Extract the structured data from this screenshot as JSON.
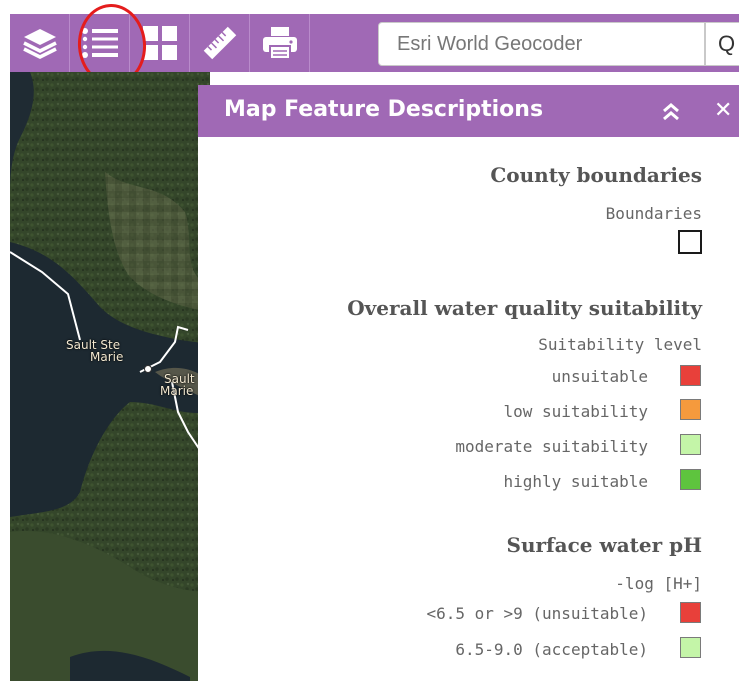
{
  "toolbar": {
    "buttons": [
      {
        "name": "layers",
        "icon": "layers-icon"
      },
      {
        "name": "legend",
        "icon": "list-icon"
      },
      {
        "name": "basemap",
        "icon": "grid-icon"
      },
      {
        "name": "measure",
        "icon": "ruler-icon"
      },
      {
        "name": "print",
        "icon": "printer-icon"
      }
    ],
    "highlighted_button": "legend",
    "search": {
      "placeholder": "Esri World Geocoder",
      "button_glyph": "Q"
    }
  },
  "map": {
    "labels": {
      "city_left_line1": "Sault Ste",
      "city_left_line2": "Marie",
      "city_right_line1": "Sault",
      "city_right_line2": "Marie"
    }
  },
  "legend_panel": {
    "title": "Map Feature Descriptions",
    "sections": [
      {
        "title": "County boundaries",
        "subtitle": "Boundaries",
        "items": []
      },
      {
        "title": "Overall water quality suitability",
        "subtitle": "Suitability level",
        "items": [
          {
            "label": "unsuitable",
            "color": "#e8403a"
          },
          {
            "label": "low suitability",
            "color": "#f59a3d"
          },
          {
            "label": "moderate suitability",
            "color": "#c4f5a8"
          },
          {
            "label": "highly suitable",
            "color": "#5ec43e"
          }
        ]
      },
      {
        "title": "Surface water pH",
        "subtitle": "-log [H+]",
        "items": [
          {
            "label": "<6.5 or >9 (unsuitable)",
            "color": "#e8403a"
          },
          {
            "label": "6.5-9.0 (acceptable)",
            "color": "#c4f5a8"
          }
        ]
      }
    ]
  },
  "colors": {
    "accent": "#a069b5",
    "highlight_circle": "#e41d1d"
  }
}
